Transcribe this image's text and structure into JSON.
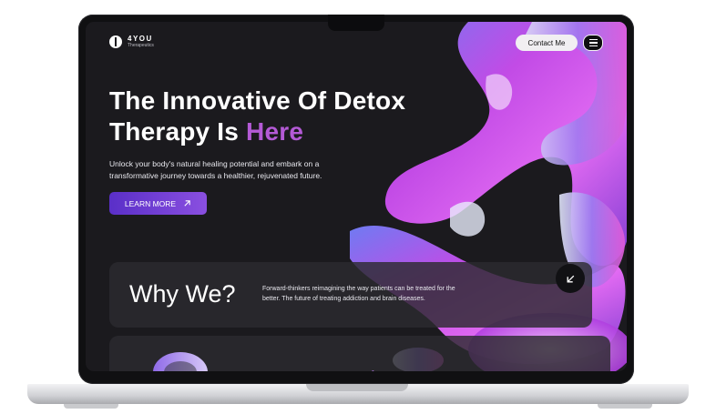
{
  "header": {
    "brand_name": "4YOU",
    "brand_sub": "Therapeutics",
    "contact_label": "Contact Me",
    "menu_icon": "hamburger-menu-icon"
  },
  "hero": {
    "title_line1": "The Innovative Of Detox",
    "title_line2_prefix": "Therapy Is ",
    "title_accent": "Here",
    "subtitle": "Unlock your body's natural healing potential and embark on a transformative journey towards a healthier, rejuvenated future.",
    "cta_label": "LEARN MORE",
    "cta_icon": "arrow-up-right-icon"
  },
  "why": {
    "title": "Why We?",
    "text": "Forward-thinkers reimagining the way patients can be treated for the better. The future of treating  addiction and brain diseases.",
    "button_icon": "arrow-down-left-icon"
  },
  "colors": {
    "background": "#1b1a1e",
    "accent": "#b45ad6",
    "cta_start": "#5a2fc8",
    "cta_end": "#8a4fe0",
    "card": "#2c2b30"
  }
}
